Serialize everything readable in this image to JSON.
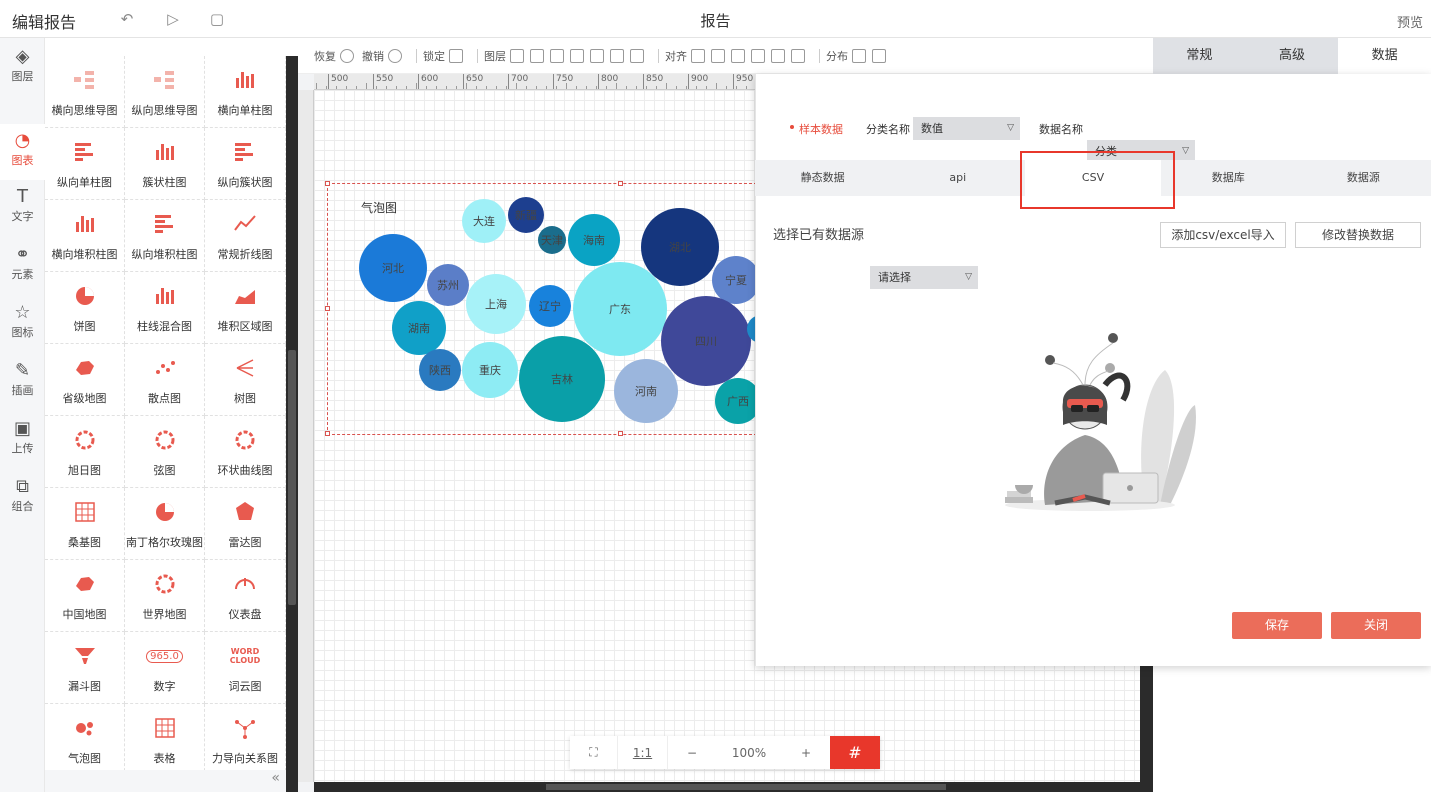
{
  "header": {
    "title": "编辑报告",
    "center_title": "报告",
    "preview": "预览"
  },
  "rail": [
    {
      "label": "图层",
      "icon": "layers-icon",
      "glyph": "◈"
    },
    {
      "label": "图表",
      "icon": "chart-icon",
      "glyph": "◔"
    },
    {
      "label": "文字",
      "icon": "text-icon",
      "glyph": "T"
    },
    {
      "label": "元素",
      "icon": "elements-icon",
      "glyph": "⚭"
    },
    {
      "label": "图标",
      "icon": "star-icon",
      "glyph": "☆"
    },
    {
      "label": "插画",
      "icon": "palette-icon",
      "glyph": "✎"
    },
    {
      "label": "上传",
      "icon": "upload-image-icon",
      "glyph": "▣"
    },
    {
      "label": "组合",
      "icon": "group-icon",
      "glyph": "⧉"
    }
  ],
  "palette": [
    "横向思维导图",
    "纵向思维导图",
    "横向单柱图",
    "纵向单柱图",
    "簇状柱图",
    "纵向簇状图",
    "横向堆积柱图",
    "纵向堆积柱图",
    "常规折线图",
    "饼图",
    "柱线混合图",
    "堆积区域图",
    "省级地图",
    "散点图",
    "树图",
    "旭日图",
    "弦图",
    "环状曲线图",
    "桑基图",
    "南丁格尔玫瑰图",
    "雷达图",
    "中国地图",
    "世界地图",
    "仪表盘",
    "漏斗图",
    "数字",
    "词云图",
    "气泡图",
    "表格",
    "力导向关系图"
  ],
  "palette_number_glyph": "965.0",
  "palette_word_glyph": "WORD",
  "palette_cloud_glyph": "CLOUD",
  "toolbar": {
    "redo": "恢复",
    "undo": "撤销",
    "lock": "锁定",
    "layer": "图层",
    "align": "对齐",
    "distribute": "分布"
  },
  "ruler_ticks": [
    "500",
    "550",
    "600",
    "650",
    "700",
    "750",
    "800",
    "850",
    "900",
    "950"
  ],
  "bubble_chart": {
    "title": "气泡图",
    "bubbles": [
      {
        "label": "大连",
        "color": "#9ff0f7"
      },
      {
        "label": "新疆",
        "color": "#1d3f8f"
      },
      {
        "label": "天津",
        "color": "#1a6d8c"
      },
      {
        "label": "海南",
        "color": "#0aa3c4"
      },
      {
        "label": "湖北",
        "color": "#15367e"
      },
      {
        "label": "河北",
        "color": "#1b7ad8"
      },
      {
        "label": "苏州",
        "color": "#5b7ec8"
      },
      {
        "label": "上海",
        "color": "#a7f2f8"
      },
      {
        "label": "辽宁",
        "color": "#1882dc"
      },
      {
        "label": "广东",
        "color": "#7ee9f1"
      },
      {
        "label": "宁夏",
        "color": "#5e82cb"
      },
      {
        "label": "湖南",
        "color": "#10a0c8"
      },
      {
        "label": "四川",
        "color": "#3f4899"
      },
      {
        "label": "陕西",
        "color": "#2a7ac0"
      },
      {
        "label": "重庆",
        "color": "#8eecf4"
      },
      {
        "label": "吉林",
        "color": "#0a9fa8"
      },
      {
        "label": "河南",
        "color": "#9bb6dd"
      },
      {
        "label": "广西",
        "color": "#0aa2a8"
      },
      {
        "label": "",
        "color": "#1e8ac8"
      }
    ]
  },
  "right_panel": {
    "tabs": [
      "常规",
      "高级",
      "数据"
    ]
  },
  "modal": {
    "sample_label": "样本数据",
    "category_name_label": "分类名称",
    "category_select": "数值",
    "data_name_label": "数据名称",
    "data_select": "分类",
    "tabs": [
      "静态数据",
      "api",
      "CSV",
      "数据库",
      "数据源"
    ],
    "active_tab": "CSV",
    "choose_source_label": "选择已有数据源",
    "choose_source_value": "请选择",
    "add_csv": "添加csv/excel导入",
    "modify_data": "修改替换数据",
    "save": "保存",
    "close": "关闭"
  },
  "zoom": {
    "fit_icon": "fit-screen-icon",
    "ratio": "1:1",
    "minus": "−",
    "level": "100%",
    "plus": "+",
    "grid_icon": "#"
  },
  "colors": {
    "accent": "#e8372b",
    "button_red": "#eb6d5a",
    "icon_red": "#e85a4f"
  }
}
